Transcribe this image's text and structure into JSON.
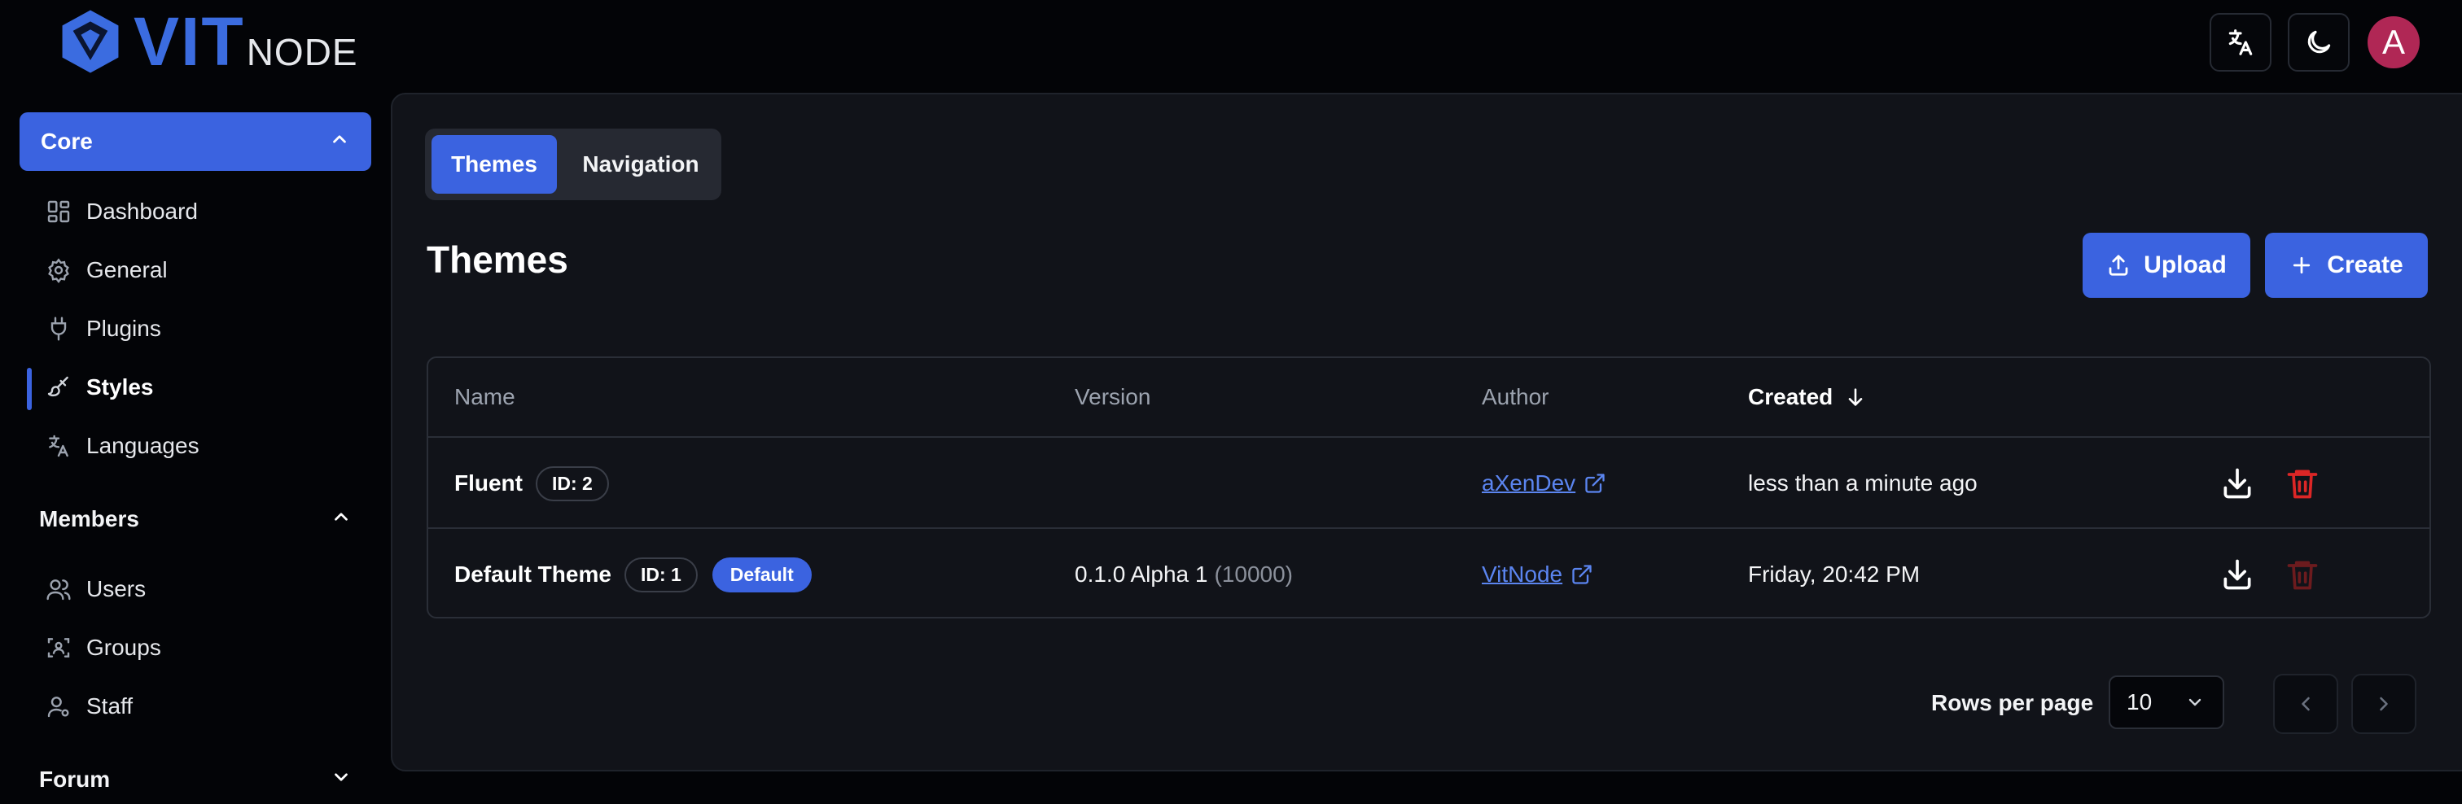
{
  "brand": {
    "part1": "VIT",
    "part2": "NODE"
  },
  "header": {
    "translate_icon": "translate-icon",
    "theme_icon": "moon-icon",
    "avatar_letter": "A"
  },
  "colors": {
    "accent": "#3b63e0",
    "danger": "#dc2626",
    "background": "#030407",
    "panel": "#111319",
    "avatar": "#b02755"
  },
  "sidebar": {
    "core": {
      "label": "Core",
      "items": [
        {
          "label": "Dashboard",
          "icon": "dashboard-icon"
        },
        {
          "label": "General",
          "icon": "gear-icon"
        },
        {
          "label": "Plugins",
          "icon": "plug-icon"
        },
        {
          "label": "Styles",
          "icon": "brush-icon",
          "active": true
        },
        {
          "label": "Languages",
          "icon": "translate-icon"
        }
      ]
    },
    "members": {
      "label": "Members",
      "items": [
        {
          "label": "Users",
          "icon": "users-icon"
        },
        {
          "label": "Groups",
          "icon": "groups-icon"
        },
        {
          "label": "Staff",
          "icon": "staff-icon"
        }
      ]
    },
    "forum": {
      "label": "Forum"
    }
  },
  "tabs": [
    {
      "label": "Themes",
      "active": true
    },
    {
      "label": "Navigation",
      "active": false
    }
  ],
  "page": {
    "title": "Themes",
    "upload_label": "Upload",
    "create_label": "Create"
  },
  "table": {
    "columns": {
      "name": "Name",
      "version": "Version",
      "author": "Author",
      "created": "Created"
    },
    "sort": {
      "column": "Created",
      "direction": "descending"
    },
    "rows": [
      {
        "name": "Fluent",
        "id_badge": "ID: 2",
        "default_badge": "",
        "version": "",
        "version_code": "",
        "author": "aXenDev",
        "created": "less than a minute ago",
        "delete_enabled": true
      },
      {
        "name": "Default Theme",
        "id_badge": "ID: 1",
        "default_badge": "Default",
        "version": "0.1.0 Alpha 1",
        "version_code": "(10000)",
        "author": "VitNode",
        "created": "Friday, 20:42 PM",
        "delete_enabled": false
      }
    ]
  },
  "pagination": {
    "rows_per_page_label": "Rows per page",
    "rows_per_page": "10"
  }
}
